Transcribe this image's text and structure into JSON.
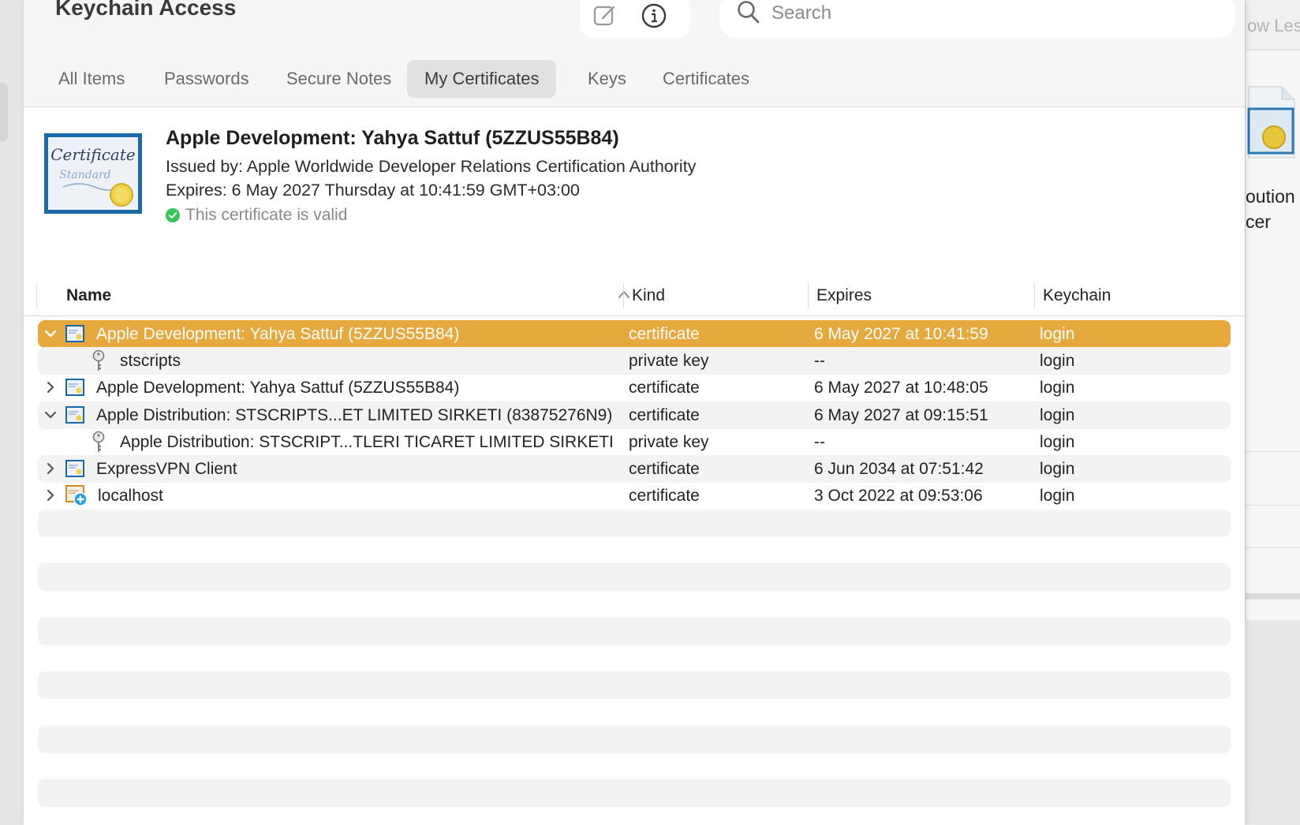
{
  "app": {
    "title": "Keychain Access"
  },
  "toolbar": {
    "new_item_icon": "compose-icon",
    "info_icon": "info-icon",
    "search_placeholder": "Search"
  },
  "tabs": [
    {
      "label": "All Items",
      "active": false
    },
    {
      "label": "Passwords",
      "active": false
    },
    {
      "label": "Secure Notes",
      "active": false
    },
    {
      "label": "My Certificates",
      "active": true
    },
    {
      "label": "Keys",
      "active": false
    },
    {
      "label": "Certificates",
      "active": false
    }
  ],
  "detail": {
    "title": "Apple Development: Yahya  Sattuf (5ZZUS55B84)",
    "issued_by": "Issued by: Apple Worldwide Developer Relations Certification Authority",
    "expires": "Expires: 6 May 2027 Thursday at 10:41:59 GMT+03:00",
    "status": "This certificate is valid",
    "status_color": "#34c759",
    "cert_art_text": [
      "Certificate",
      "Standard"
    ]
  },
  "table": {
    "columns": [
      "Name",
      "Kind",
      "Expires",
      "Keychain"
    ],
    "sort_column": "Name",
    "rows": [
      {
        "name": "Apple Development: Yahya  Sattuf (5ZZUS55B84)",
        "kind": "certificate",
        "expires": "6 May 2027 at 10:41:59",
        "keychain": "login",
        "icon": "certificate-icon",
        "expanded": true,
        "selected": true,
        "level": 0
      },
      {
        "name": "stscripts",
        "kind": "private key",
        "expires": "--",
        "keychain": "login",
        "icon": "key-icon",
        "level": 1
      },
      {
        "name": "Apple Development: Yahya  Sattuf (5ZZUS55B84)",
        "kind": "certificate",
        "expires": "6 May 2027 at 10:48:05",
        "keychain": "login",
        "icon": "certificate-icon",
        "expanded": false,
        "level": 0
      },
      {
        "name": "Apple Distribution: STSCRIPTS...ET LIMITED SIRKETI (83875276N9)",
        "kind": "certificate",
        "expires": "6 May 2027 at 09:15:51",
        "keychain": "login",
        "icon": "certificate-icon",
        "expanded": true,
        "level": 0
      },
      {
        "name": "Apple Distribution: STSCRIPT...TLERI TICARET LIMITED SIRKETI",
        "kind": "private key",
        "expires": "--",
        "keychain": "login",
        "icon": "key-icon",
        "level": 1
      },
      {
        "name": "ExpressVPN Client",
        "kind": "certificate",
        "expires": "6 Jun 2034 at 07:51:42",
        "keychain": "login",
        "icon": "certificate-icon",
        "expanded": false,
        "level": 0
      },
      {
        "name": "localhost",
        "kind": "certificate",
        "expires": "3 Oct 2022 at 09:53:06",
        "keychain": "login",
        "icon": "certificate-custom-trust-icon",
        "expanded": false,
        "level": 0
      }
    ]
  },
  "background_window": {
    "button_fragment": "ow Les",
    "text_line_1": "oution",
    "text_line_2": "cer"
  },
  "colors": {
    "selection": "#e5a93d",
    "alt_row": "#f3f3f3",
    "toolbar_bg": "#f6f6f6"
  }
}
